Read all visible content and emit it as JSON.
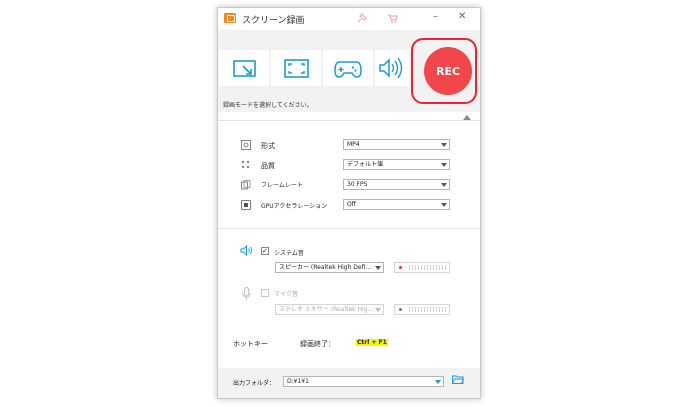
{
  "window": {
    "title": "スクリーン録画",
    "icons": {
      "pin": "pin-icon",
      "cart": "cart-icon",
      "minimize": "–",
      "close": "✕"
    }
  },
  "modes": {
    "buttons": [
      {
        "name": "region-mode",
        "icon": "region-select-icon"
      },
      {
        "name": "fullscreen-mode",
        "icon": "fullscreen-icon"
      },
      {
        "name": "game-mode",
        "icon": "gamepad-icon"
      },
      {
        "name": "audio-mode",
        "icon": "speaker-icon"
      }
    ],
    "rec_label": "REC",
    "hint": "録画モードを選択してください。"
  },
  "settings": {
    "format": {
      "label": "形式",
      "value": "MP4"
    },
    "quality": {
      "label": "品質",
      "value": "デフォルト値"
    },
    "framerate": {
      "label": "フレームレート",
      "value": "30 FPS"
    },
    "gpu": {
      "label": "GPUアクセラレーション",
      "value": "Off"
    }
  },
  "audio": {
    "system": {
      "label": "システム音",
      "checked": "✓",
      "device": "スピーカー (Realtek High Defi..."
    },
    "mic": {
      "label": "マイク音",
      "checked": "",
      "device": "ステレオ ミキサー (Realtek Hig..."
    }
  },
  "hotkey": {
    "label": "ホットキー",
    "action": "録画終了：",
    "keys": "Ctrl + F1"
  },
  "output": {
    "label": "出力フォルダ：",
    "path": "D:¥1¥1"
  },
  "colors": {
    "accent": "#1a9bd7",
    "rec": "#f2464b",
    "highlight": "#e8262e"
  }
}
